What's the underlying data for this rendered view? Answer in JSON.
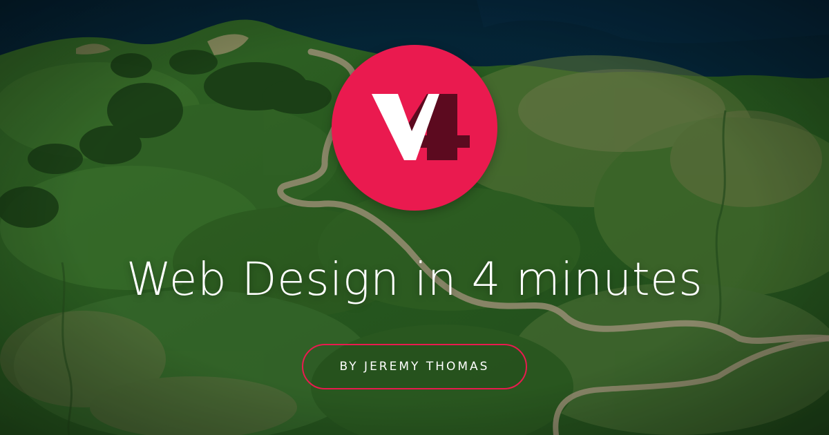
{
  "hero": {
    "background": "aerial-green-hills-coastline",
    "title": "Web Design in 4 minutes",
    "byline": "BY JEREMY THOMAS"
  },
  "logo": {
    "icon": "v4-logo-icon",
    "text": "V4",
    "circle_color": "#ea1a4f",
    "v_color": "#ffffff",
    "four_color": "#5c0a1f"
  },
  "colors": {
    "accent": "#ea1a4f",
    "text": "#ffffff"
  }
}
